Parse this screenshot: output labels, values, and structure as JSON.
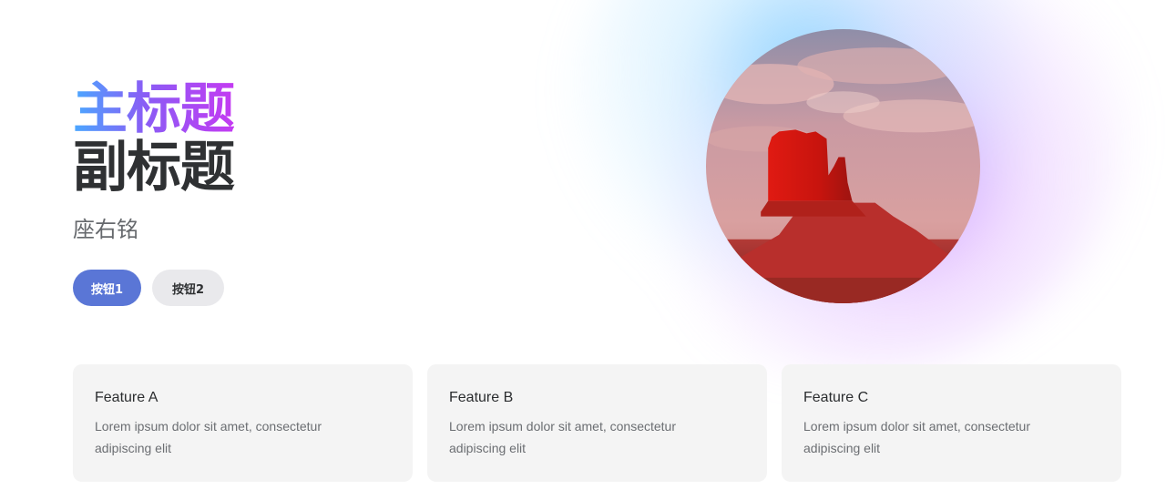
{
  "hero": {
    "title": "主标题",
    "subtitle": "副标题",
    "motto": "座右铭",
    "primary_button": "按钮1",
    "secondary_button": "按钮2",
    "image_subject": "red-butte-landscape",
    "gradient_colors": [
      "#4aa8ff",
      "#8a5cf5",
      "#c43bf2"
    ],
    "accent_color": "#5a76d6"
  },
  "features": [
    {
      "title": "Feature A",
      "description": "Lorem ipsum dolor sit amet, consectetur adipiscing elit"
    },
    {
      "title": "Feature B",
      "description": "Lorem ipsum dolor sit amet, consectetur adipiscing elit"
    },
    {
      "title": "Feature C",
      "description": "Lorem ipsum dolor sit amet, consectetur adipiscing elit"
    }
  ]
}
